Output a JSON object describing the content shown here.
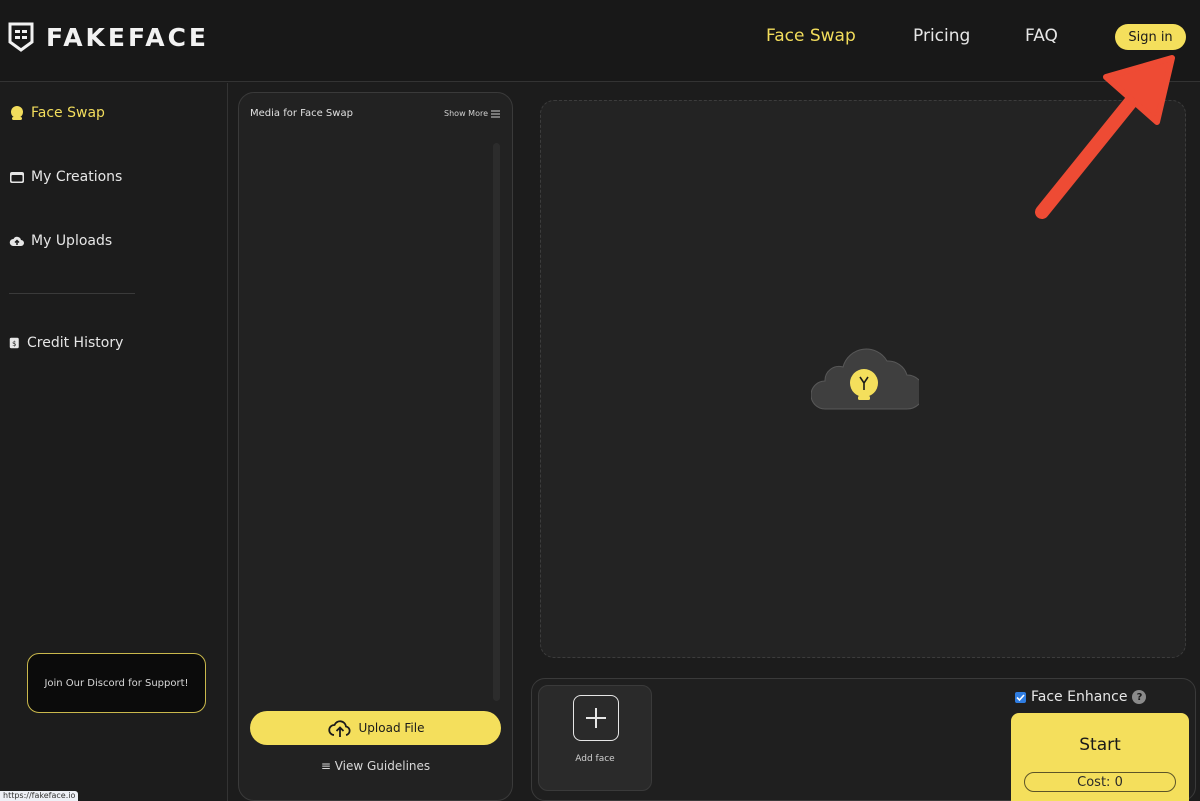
{
  "header": {
    "logo_text": "FAKEFACE",
    "nav": {
      "face_swap": "Face Swap",
      "pricing": "Pricing",
      "faq": "FAQ"
    },
    "sign_in": "Sign in",
    "active_color": "#f2dd5c"
  },
  "sidebar": {
    "items": [
      {
        "label": "Face Swap",
        "icon": "face-icon",
        "active": true
      },
      {
        "label": "My Creations",
        "icon": "folder-icon",
        "active": false
      },
      {
        "label": "My Uploads",
        "icon": "cloud-upload-icon",
        "active": false
      },
      {
        "label": "Credit History",
        "icon": "credit-icon",
        "active": false
      }
    ],
    "discord": "Join Our Discord for Support!"
  },
  "status_url": "https://fakeface.io",
  "media": {
    "title": "Media for Face Swap",
    "show_more": "Show More",
    "upload": "Upload File",
    "guidelines": "≡ View Guidelines"
  },
  "preview": {
    "icon": "cloud-lightbulb-icon"
  },
  "controls": {
    "add_face": "Add face",
    "face_enhance": "Face Enhance",
    "face_enhance_checked": true,
    "help": "?",
    "start": "Start",
    "cost": "Cost: 0"
  },
  "accent_color": "#f4df5c",
  "annotation_color": "#ee4b34"
}
